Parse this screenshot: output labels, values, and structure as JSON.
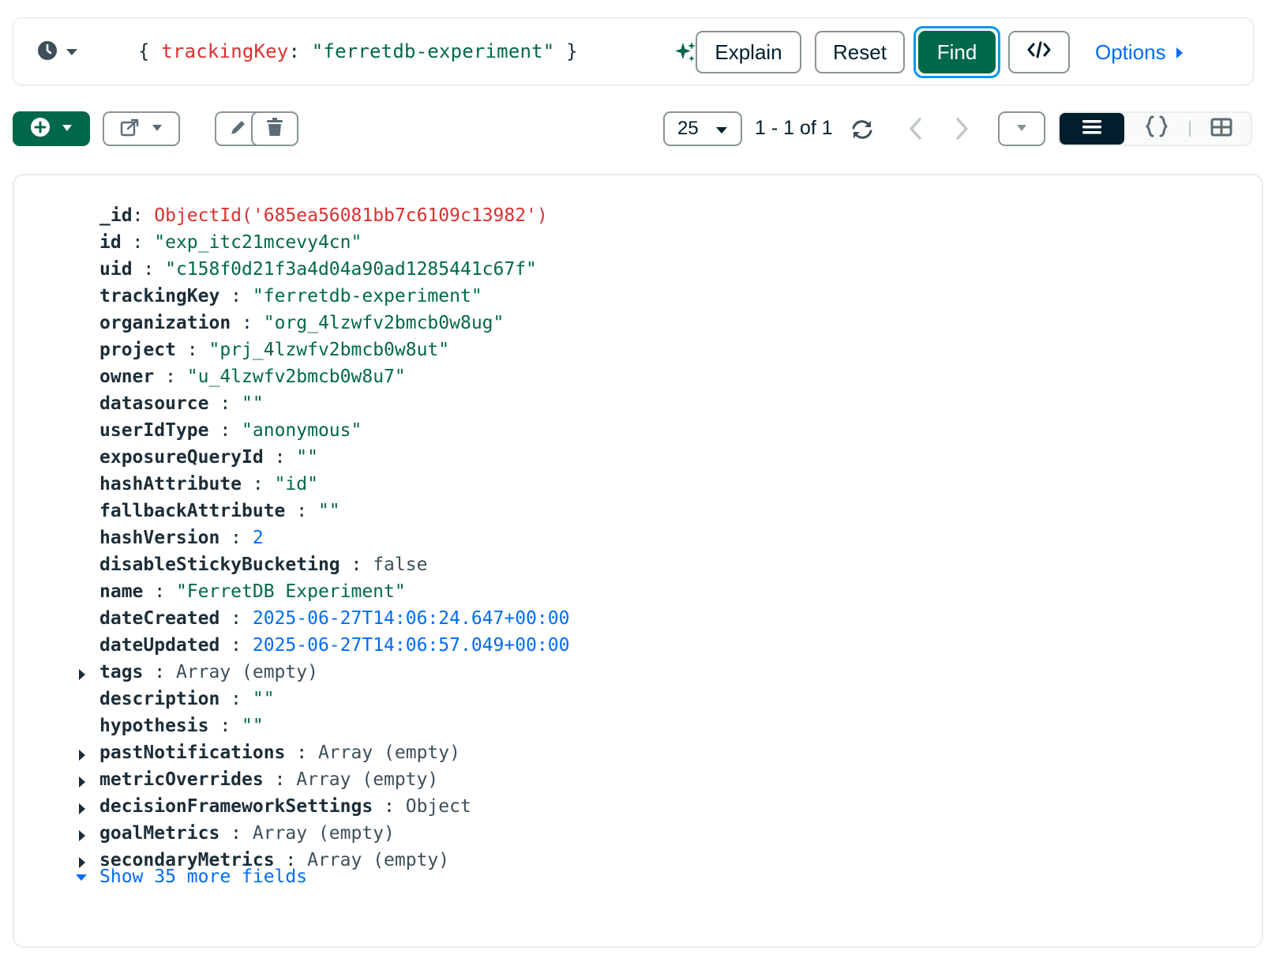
{
  "query": {
    "open_brace": "{ ",
    "key": "trackingKey",
    "colon": ": ",
    "value": "\"ferretdb-experiment\"",
    "close_brace": " }"
  },
  "buttons": {
    "explain": "Explain",
    "reset": "Reset",
    "find": "Find",
    "options": "Options"
  },
  "pagination": {
    "page_size": "25",
    "range": "1 - 1 of 1"
  },
  "colors": {
    "accent_green": "#00684a",
    "link_blue": "#016bf8",
    "key_red": "#db3030"
  },
  "document": {
    "fields": [
      {
        "key": "_id",
        "sep": ": ",
        "value": "ObjectId('685ea56081bb7c6109c13982')",
        "type": "oid",
        "expandable": false
      },
      {
        "key": "id",
        "sep": " : ",
        "value": "\"exp_itc21mcevy4cn\"",
        "type": "str",
        "expandable": false
      },
      {
        "key": "uid",
        "sep": " : ",
        "value": "\"c158f0d21f3a4d04a90ad1285441c67f\"",
        "type": "str",
        "expandable": false
      },
      {
        "key": "trackingKey",
        "sep": " : ",
        "value": "\"ferretdb-experiment\"",
        "type": "str",
        "expandable": false
      },
      {
        "key": "organization",
        "sep": " : ",
        "value": "\"org_4lzwfv2bmcb0w8ug\"",
        "type": "str",
        "expandable": false
      },
      {
        "key": "project",
        "sep": " : ",
        "value": "\"prj_4lzwfv2bmcb0w8ut\"",
        "type": "str",
        "expandable": false
      },
      {
        "key": "owner",
        "sep": " : ",
        "value": "\"u_4lzwfv2bmcb0w8u7\"",
        "type": "str",
        "expandable": false
      },
      {
        "key": "datasource",
        "sep": " : ",
        "value": "\"\"",
        "type": "str",
        "expandable": false
      },
      {
        "key": "userIdType",
        "sep": " : ",
        "value": "\"anonymous\"",
        "type": "str",
        "expandable": false
      },
      {
        "key": "exposureQueryId",
        "sep": " : ",
        "value": "\"\"",
        "type": "str",
        "expandable": false
      },
      {
        "key": "hashAttribute",
        "sep": " : ",
        "value": "\"id\"",
        "type": "str",
        "expandable": false
      },
      {
        "key": "fallbackAttribute",
        "sep": " : ",
        "value": "\"\"",
        "type": "str",
        "expandable": false
      },
      {
        "key": "hashVersion",
        "sep": " : ",
        "value": "2",
        "type": "num",
        "expandable": false
      },
      {
        "key": "disableStickyBucketing",
        "sep": " : ",
        "value": "false",
        "type": "bool",
        "expandable": false
      },
      {
        "key": "name",
        "sep": " : ",
        "value": "\"FerretDB Experiment\"",
        "type": "str",
        "expandable": false
      },
      {
        "key": "dateCreated",
        "sep": " : ",
        "value": "2025-06-27T14:06:24.647+00:00",
        "type": "date",
        "expandable": false
      },
      {
        "key": "dateUpdated",
        "sep": " : ",
        "value": "2025-06-27T14:06:57.049+00:00",
        "type": "date",
        "expandable": false
      },
      {
        "key": "tags",
        "sep": " : ",
        "value": "Array (empty)",
        "type": "plain",
        "expandable": true
      },
      {
        "key": "description",
        "sep": " : ",
        "value": "\"\"",
        "type": "str",
        "expandable": false
      },
      {
        "key": "hypothesis",
        "sep": " : ",
        "value": "\"\"",
        "type": "str",
        "expandable": false
      },
      {
        "key": "pastNotifications",
        "sep": " : ",
        "value": "Array (empty)",
        "type": "plain",
        "expandable": true
      },
      {
        "key": "metricOverrides",
        "sep": " : ",
        "value": "Array (empty)",
        "type": "plain",
        "expandable": true
      },
      {
        "key": "decisionFrameworkSettings",
        "sep": " : ",
        "value": "Object",
        "type": "plain",
        "expandable": true
      },
      {
        "key": "goalMetrics",
        "sep": " : ",
        "value": "Array (empty)",
        "type": "plain",
        "expandable": true
      },
      {
        "key": "secondaryMetrics",
        "sep": " : ",
        "value": "Array (empty)",
        "type": "plain",
        "expandable": true
      }
    ],
    "show_more": "Show 35 more fields"
  },
  "icons": {
    "history": "clock-icon",
    "ai": "sparkle-icon",
    "code": "code-icon",
    "add": "plus-circle-icon",
    "export": "export-icon",
    "edit": "pencil-icon",
    "delete": "trash-icon",
    "refresh": "refresh-icon",
    "list_view": "list-icon",
    "json_view": "braces-icon",
    "table_view": "table-icon"
  }
}
